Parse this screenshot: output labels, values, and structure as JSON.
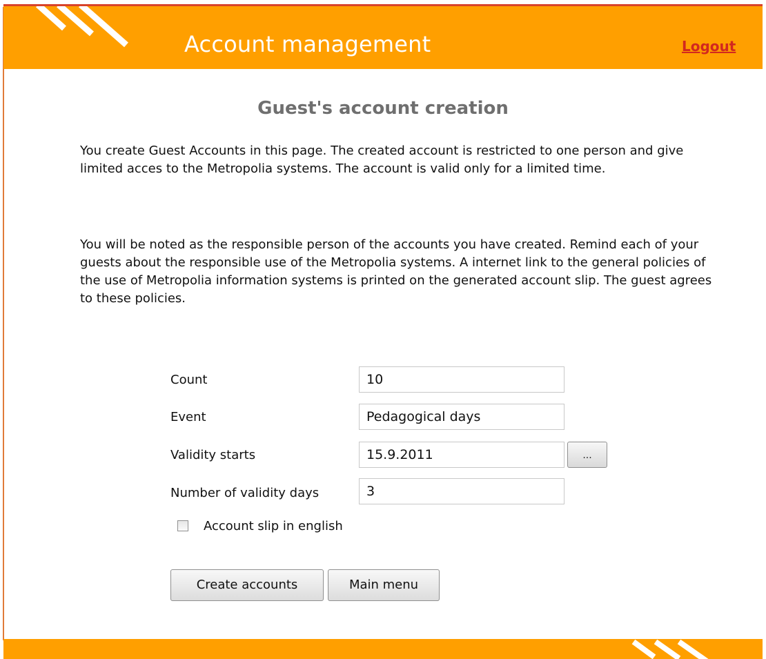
{
  "header": {
    "title": "Account management",
    "logout_label": "Logout"
  },
  "page": {
    "title": "Guest's account creation",
    "paragraph1": "You create Guest Accounts in this page. The created account is restricted to one person and give limited acces to the Metropolia systems. The account is valid only for a limited time.",
    "paragraph2": "You will be noted as the responsible person of the accounts you have created. Remind each of your guests about the responsible use of the Metropolia systems. A internet link to the general policies of the use of Metropolia information systems is printed on the generated account slip. The guest agrees to these policies."
  },
  "form": {
    "count_label": "Count",
    "count_value": "10",
    "event_label": "Event",
    "event_value": "Pedagogical days",
    "validity_start_label": "Validity starts",
    "validity_start_value": "15.9.2011",
    "date_picker_label": "...",
    "validity_days_label": "Number of validity days",
    "validity_days_value": "3",
    "english_slip_label": "Account slip in english",
    "english_slip_checked": false
  },
  "buttons": {
    "create_label": "Create accounts",
    "main_menu_label": "Main menu"
  },
  "colors": {
    "header_bg": "#ff9f00",
    "header_top_line": "#d8432a",
    "logout": "#d2281f",
    "title_gray": "#6f6f6f"
  }
}
